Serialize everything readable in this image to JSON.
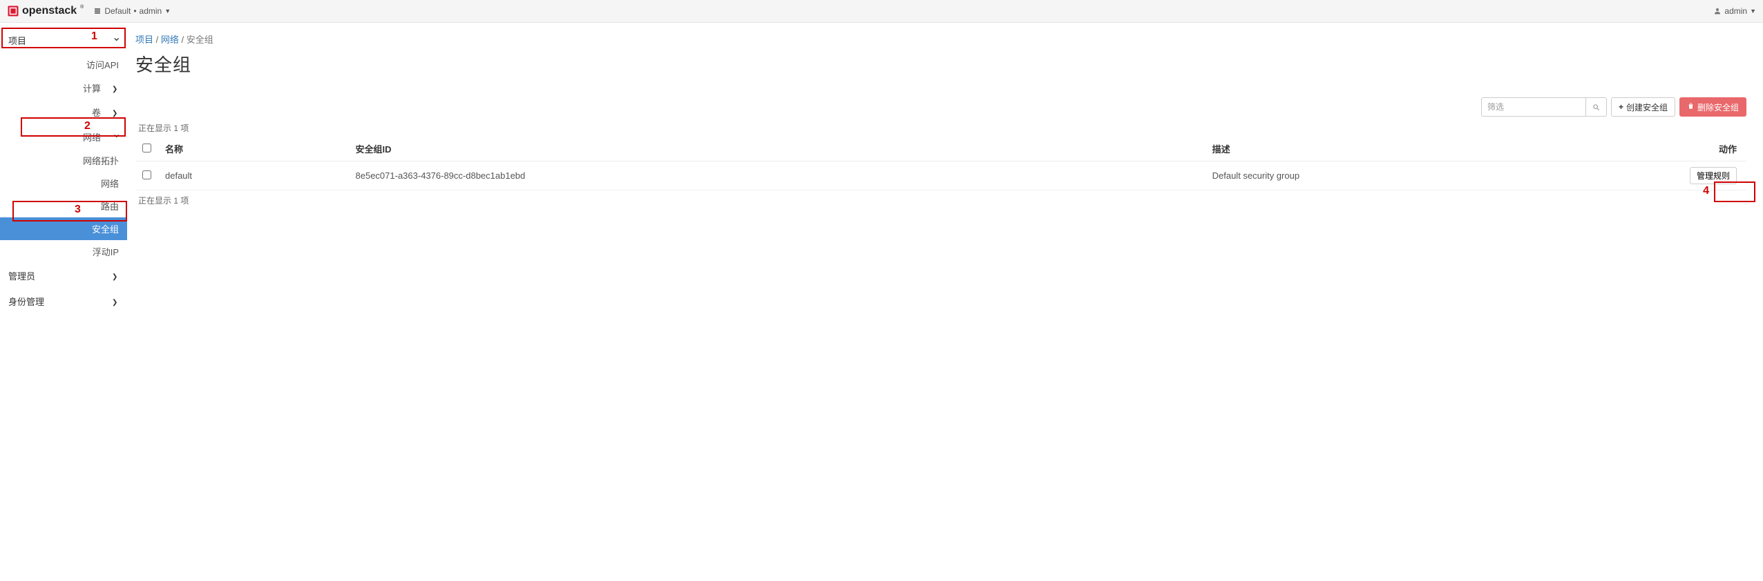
{
  "brand": "openstack",
  "context": {
    "project": "Default",
    "user": "admin"
  },
  "user_menu": {
    "name": "admin"
  },
  "sidebar": {
    "project": {
      "label": "项目",
      "expanded": true
    },
    "access_api": {
      "label": "访问API"
    },
    "compute": {
      "label": "计算"
    },
    "volumes": {
      "label": "卷"
    },
    "network": {
      "label": "网络",
      "expanded": true
    },
    "net_topology": {
      "label": "网络拓扑"
    },
    "networks": {
      "label": "网络"
    },
    "routers": {
      "label": "路由"
    },
    "secgroups": {
      "label": "安全组"
    },
    "floatingip": {
      "label": "浮动IP"
    },
    "admin": {
      "label": "管理员"
    },
    "identity": {
      "label": "身份管理"
    }
  },
  "breadcrumb": {
    "a": "项目",
    "b": "网络",
    "c": "安全组"
  },
  "page_title": "安全组",
  "filter": {
    "placeholder": "筛选"
  },
  "buttons": {
    "create": "创建安全组",
    "delete": "删除安全组",
    "manage_rules": "管理规则"
  },
  "count_text_top": "正在显示 1 项",
  "count_text_bottom": "正在显示 1 项",
  "columns": {
    "name": "名称",
    "id": "安全组ID",
    "desc": "描述",
    "action": "动作"
  },
  "rows": [
    {
      "name": "default",
      "id": "8e5ec071-a363-4376-89cc-d8bec1ab1ebd",
      "desc": "Default security group"
    }
  ],
  "annotations": {
    "n1": "1",
    "n2": "2",
    "n3": "3",
    "n4": "4"
  }
}
